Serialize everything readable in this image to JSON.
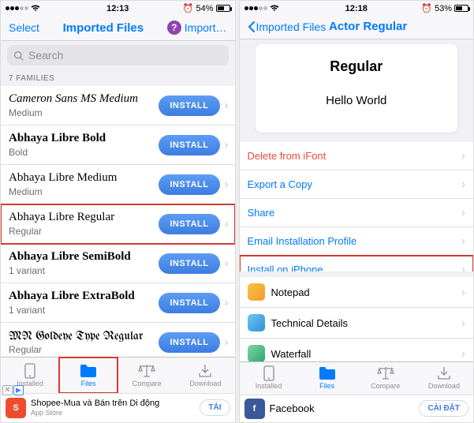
{
  "left": {
    "status": {
      "time": "12:13",
      "battery_pct": "54%"
    },
    "nav": {
      "left": "Select",
      "title": "Imported Files",
      "right": "Import…"
    },
    "search_placeholder": "Search",
    "section_header": "7 FAMILIES",
    "install_label": "INSTALL",
    "fonts": [
      {
        "name": "Cameron Sans MS Medium",
        "sub": "Medium",
        "css": "font-script"
      },
      {
        "name": "Abhaya Libre Bold",
        "sub": "Bold",
        "css": "font-serif-bold"
      },
      {
        "name": "Abhaya Libre Medium",
        "sub": "Medium",
        "css": "font-serif"
      },
      {
        "name": "Abhaya Libre Regular",
        "sub": "Regular",
        "css": "font-serif",
        "highlight": true
      },
      {
        "name": "Abhaya Libre SemiBold",
        "sub": "1 variant",
        "css": "font-serif-bold"
      },
      {
        "name": "Abhaya Libre ExtraBold",
        "sub": "1 variant",
        "css": "font-serif-bold"
      },
      {
        "name": "MN Goldeye Type Regular",
        "sub": "Regular",
        "css": "font-blackletter"
      }
    ],
    "tabs": [
      {
        "label": "Installed"
      },
      {
        "label": "Files",
        "active": true,
        "highlight": true
      },
      {
        "label": "Compare"
      },
      {
        "label": "Download"
      }
    ],
    "ad": {
      "title": "Shopee-Mua và Bán trên Di động",
      "sub": "App Store",
      "cta": "TẢI",
      "icon_bg": "#ee4d2d",
      "icon_letter": "S"
    }
  },
  "right": {
    "status": {
      "time": "12:18",
      "battery_pct": "53%"
    },
    "nav": {
      "back": "Imported Files",
      "title": "Actor Regular"
    },
    "preview": {
      "title": "Regular",
      "sample": "Hello World"
    },
    "actions": [
      {
        "label": "Delete from iFont",
        "kind": "danger"
      },
      {
        "label": "Export a Copy",
        "kind": "link"
      },
      {
        "label": "Share",
        "kind": "link"
      },
      {
        "label": "Email Installation Profile",
        "kind": "link"
      },
      {
        "label": "Install on iPhone",
        "kind": "link",
        "highlight": true
      }
    ],
    "apps": [
      {
        "label": "Notepad",
        "color1": "#f6c244",
        "color2": "#f29b2e"
      },
      {
        "label": "Technical Details",
        "color1": "#6ec6f2",
        "color2": "#2f8fd6"
      },
      {
        "label": "Waterfall",
        "color1": "#7ed6a5",
        "color2": "#2fa56a"
      }
    ],
    "tabs": [
      {
        "label": "Installed"
      },
      {
        "label": "Files",
        "active": true
      },
      {
        "label": "Compare"
      },
      {
        "label": "Download"
      }
    ],
    "ad": {
      "title": "Facebook",
      "cta": "CÀI ĐẶT",
      "icon_bg": "#3b5998",
      "icon_letter": "f"
    }
  }
}
